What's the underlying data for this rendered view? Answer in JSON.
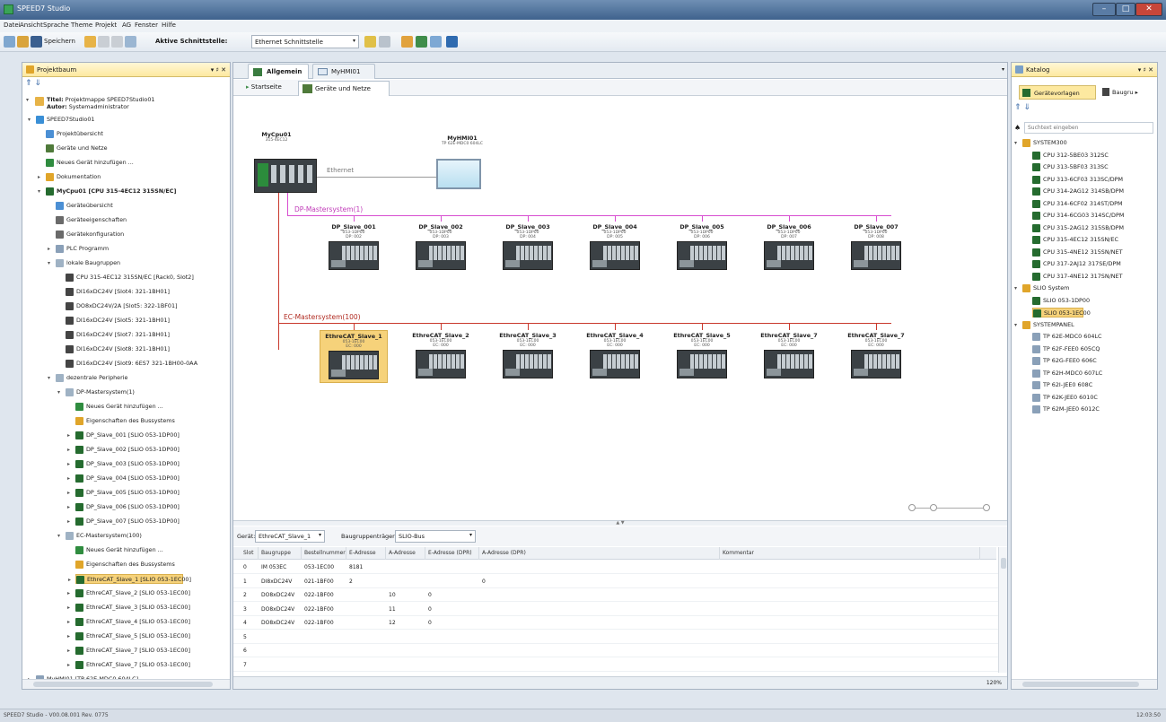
{
  "window": {
    "title": "SPEED7 Studio",
    "minimize": "–",
    "maximize": "□",
    "close": "✕"
  },
  "menu": [
    "Datei",
    "Ansicht",
    "Sprache",
    "Theme",
    "Projekt",
    "AG",
    "Fenster",
    "Hilfe"
  ],
  "toolbar": {
    "save_label": "Speichern",
    "interface_label": "Aktive Schnittstelle:",
    "interface_value": "Ethernet Schnittstelle"
  },
  "projecttree": {
    "title": "Projektbaum",
    "pin": "▾ ♯ ✕",
    "root_title_label": "Titel:",
    "root_title_value": "Projektmappe SPEED7Studio01",
    "root_author_label": "Autor:",
    "root_author_value": "Systemadministrator",
    "items": [
      {
        "label": "SPEED7Studio01",
        "indent": 1,
        "arrow": "▾",
        "color": "#3a8fd6"
      },
      {
        "label": "Projektübersicht",
        "indent": 2,
        "arrow": "",
        "color": "#4b8fd4"
      },
      {
        "label": "Geräte und Netze",
        "indent": 2,
        "arrow": "",
        "color": "#4f7a3a"
      },
      {
        "label": "Neues Gerät hinzufügen ...",
        "indent": 2,
        "arrow": "",
        "color": "#2f8c3f"
      },
      {
        "label": "Dokumentation",
        "indent": 2,
        "arrow": "▸",
        "color": "#e0a52a"
      },
      {
        "label": "MyCpu01 [CPU 315-4EC12 315SN/EC]",
        "indent": 2,
        "arrow": "▾",
        "color": "#256b2f",
        "bold": true
      },
      {
        "label": "Geräteübersicht",
        "indent": 3,
        "arrow": "",
        "color": "#4b8fd4"
      },
      {
        "label": "Geräteeigenschaften",
        "indent": 3,
        "arrow": "",
        "color": "#6a6a6a"
      },
      {
        "label": "Gerätekonfiguration",
        "indent": 3,
        "arrow": "",
        "color": "#6a6a6a"
      },
      {
        "label": "PLC Programm",
        "indent": 3,
        "arrow": "▸",
        "color": "#8aa0b8"
      },
      {
        "label": "lokale Baugruppen",
        "indent": 3,
        "arrow": "▾",
        "color": "#9fb2c4"
      },
      {
        "label": "CPU 315-4EC12 315SN/EC [Rack0, Slot2]",
        "indent": 4,
        "arrow": "",
        "color": "#444"
      },
      {
        "label": "DI16xDC24V [Slot4: 321-1BH01]",
        "indent": 4,
        "arrow": "",
        "color": "#444"
      },
      {
        "label": "DO8xDC24V/2A [Slot5: 322-1BF01]",
        "indent": 4,
        "arrow": "",
        "color": "#444"
      },
      {
        "label": "DI16xDC24V [Slot5: 321-1BH01]",
        "indent": 4,
        "arrow": "",
        "color": "#444"
      },
      {
        "label": "DI16xDC24V [Slot7: 321-1BH01]",
        "indent": 4,
        "arrow": "",
        "color": "#444"
      },
      {
        "label": "DI16xDC24V [Slot8: 321-1BH01]",
        "indent": 4,
        "arrow": "",
        "color": "#444"
      },
      {
        "label": "DI16xDC24V [Slot9: 6ES7 321-1BH00-0AA",
        "indent": 4,
        "arrow": "",
        "color": "#444"
      },
      {
        "label": "dezentrale Peripherie",
        "indent": 3,
        "arrow": "▾",
        "color": "#9fb2c4"
      },
      {
        "label": "DP-Mastersystem(1)",
        "indent": 4,
        "arrow": "▾",
        "color": "#9fb2c4"
      },
      {
        "label": "Neues Gerät hinzufügen ...",
        "indent": 5,
        "arrow": "",
        "color": "#2f8c3f"
      },
      {
        "label": "Eigenschaften des Bussystems",
        "indent": 5,
        "arrow": "",
        "color": "#e0a52a"
      },
      {
        "label": "DP_Slave_001 [SLIO 053-1DP00]",
        "indent": 5,
        "arrow": "▸",
        "color": "#256b2f"
      },
      {
        "label": "DP_Slave_002 [SLIO 053-1DP00]",
        "indent": 5,
        "arrow": "▸",
        "color": "#256b2f"
      },
      {
        "label": "DP_Slave_003 [SLIO 053-1DP00]",
        "indent": 5,
        "arrow": "▸",
        "color": "#256b2f"
      },
      {
        "label": "DP_Slave_004 [SLIO 053-1DP00]",
        "indent": 5,
        "arrow": "▸",
        "color": "#256b2f"
      },
      {
        "label": "DP_Slave_005 [SLIO 053-1DP00]",
        "indent": 5,
        "arrow": "▸",
        "color": "#256b2f"
      },
      {
        "label": "DP_Slave_006 [SLIO 053-1DP00]",
        "indent": 5,
        "arrow": "▸",
        "color": "#256b2f"
      },
      {
        "label": "DP_Slave_007 [SLIO 053-1DP00]",
        "indent": 5,
        "arrow": "▸",
        "color": "#256b2f"
      },
      {
        "label": "EC-Mastersystem(100)",
        "indent": 4,
        "arrow": "▾",
        "color": "#9fb2c4"
      },
      {
        "label": "Neues Gerät hinzufügen ...",
        "indent": 5,
        "arrow": "",
        "color": "#2f8c3f"
      },
      {
        "label": "Eigenschaften des Bussystems",
        "indent": 5,
        "arrow": "",
        "color": "#e0a52a"
      },
      {
        "label": "EthreCAT_Slave_1 [SLIO 053-1EC00]",
        "indent": 5,
        "arrow": "▸",
        "color": "#256b2f",
        "selected": true
      },
      {
        "label": "EthreCAT_Slave_2 [SLIO 053-1EC00]",
        "indent": 5,
        "arrow": "▸",
        "color": "#256b2f"
      },
      {
        "label": "EthreCAT_Slave_3 [SLIO 053-1EC00]",
        "indent": 5,
        "arrow": "▸",
        "color": "#256b2f"
      },
      {
        "label": "EthreCAT_Slave_4 [SLIO 053-1EC00]",
        "indent": 5,
        "arrow": "▸",
        "color": "#256b2f"
      },
      {
        "label": "EthreCAT_Slave_5 [SLIO 053-1EC00]",
        "indent": 5,
        "arrow": "▸",
        "color": "#256b2f"
      },
      {
        "label": "EthreCAT_Slave_7 [SLIO 053-1EC00]",
        "indent": 5,
        "arrow": "▸",
        "color": "#256b2f"
      },
      {
        "label": "EthreCAT_Slave_7 [SLIO 053-1EC00]",
        "indent": 5,
        "arrow": "▸",
        "color": "#256b2f"
      },
      {
        "label": "MyHMI01 [TP 62E-MDC0 604LC]",
        "indent": 1,
        "arrow": "▸",
        "color": "#8aa0b8"
      }
    ]
  },
  "tabs": {
    "main": [
      "Allgemein",
      "MyHMI01"
    ],
    "sub": [
      "Startseite",
      "Geräte und Netze"
    ]
  },
  "network": {
    "cpu_name": "MyCpu01",
    "cpu_sub": "315-4EC12",
    "hmi_name": "MyHMI01",
    "hmi_sub": "TP 62E-MDC0 604LC",
    "ethernet": "Ethernet",
    "dp_master": "DP-Mastersystem(1)",
    "ec_master": "EC-Mastersystem(100)",
    "dp_slaves": [
      {
        "name": "DP_Slave_001",
        "sub1": "053-1DP00",
        "sub2": "DP: 002"
      },
      {
        "name": "DP_Slave_002",
        "sub1": "053-1DP00",
        "sub2": "DP: 003"
      },
      {
        "name": "DP_Slave_003",
        "sub1": "053-1DP00",
        "sub2": "DP: 004"
      },
      {
        "name": "DP_Slave_004",
        "sub1": "053-1DP00",
        "sub2": "DP: 005"
      },
      {
        "name": "DP_Slave_005",
        "sub1": "053-1DP00",
        "sub2": "DP: 006"
      },
      {
        "name": "DP_Slave_006",
        "sub1": "053-1DP00",
        "sub2": "DP: 007"
      },
      {
        "name": "DP_Slave_007",
        "sub1": "053-1DP00",
        "sub2": "DP: 008"
      }
    ],
    "ec_slaves": [
      {
        "name": "EthreCAT_Slave_1",
        "sub1": "053-1EC00",
        "sub2": "EC: 000",
        "selected": true
      },
      {
        "name": "EthreCAT_Slave_2",
        "sub1": "053-1EC00",
        "sub2": "EC: 000"
      },
      {
        "name": "EthreCAT_Slave_3",
        "sub1": "053-1EC00",
        "sub2": "EC: 000"
      },
      {
        "name": "EthreCAT_Slave_4",
        "sub1": "053-1EC00",
        "sub2": "EC: 000"
      },
      {
        "name": "EthreCAT_Slave_5",
        "sub1": "053-1EC00",
        "sub2": "EC: 000"
      },
      {
        "name": "EthreCAT_Slave_7",
        "sub1": "053-1EC00",
        "sub2": "EC: 000"
      },
      {
        "name": "EthreCAT_Slave_7",
        "sub1": "053-1EC00",
        "sub2": "EC: 000"
      }
    ]
  },
  "devicegrid": {
    "geraet_label": "Gerät:",
    "geraet_value": "EthreCAT_Slave_1",
    "traeger_label": "Baugruppenträger:",
    "traeger_value": "SLIO-Bus",
    "columns": [
      "Slot",
      "Baugruppe",
      "Bestellnummer",
      "E-Adresse",
      "A-Adresse",
      "E-Adresse (DPR)",
      "A-Adresse (DPR)",
      "Kommentar"
    ],
    "rows": [
      [
        "0",
        "IM 053EC",
        "053-1EC00",
        "8181",
        "",
        "",
        "",
        ""
      ],
      [
        "1",
        "DI8xDC24V",
        "021-1BF00",
        "2",
        "",
        "",
        "0",
        ""
      ],
      [
        "2",
        "DO8xDC24V",
        "022-1BF00",
        "",
        "10",
        "0",
        "",
        ""
      ],
      [
        "3",
        "DO8xDC24V",
        "022-1BF00",
        "",
        "11",
        "0",
        "",
        ""
      ],
      [
        "4",
        "DO8xDC24V",
        "022-1BF00",
        "",
        "12",
        "0",
        "",
        ""
      ],
      [
        "5",
        "",
        "",
        "",
        "",
        "",
        "",
        ""
      ],
      [
        "6",
        "",
        "",
        "",
        "",
        "",
        "",
        ""
      ],
      [
        "7",
        "",
        "",
        "",
        "",
        "",
        "",
        ""
      ]
    ],
    "zoom": "120%"
  },
  "catalog": {
    "title": "Katalog",
    "pin": "▾ ♯ ✕",
    "tab1": "Gerätevorlagen",
    "tab2": "Baugru",
    "search_placeholder": "Suchtext eingeben",
    "items": [
      {
        "label": "SYSTEM300",
        "indent": 0,
        "arrow": "▾",
        "color": "#e0a52a"
      },
      {
        "label": "CPU 312-5BE03 312SC",
        "indent": 1,
        "arrow": "",
        "color": "#256b2f"
      },
      {
        "label": "CPU 313-5BF03 313SC",
        "indent": 1,
        "arrow": "",
        "color": "#256b2f"
      },
      {
        "label": "CPU 313-6CF03 313SC/DPM",
        "indent": 1,
        "arrow": "",
        "color": "#256b2f"
      },
      {
        "label": "CPU 314-2AG12 314SB/DPM",
        "indent": 1,
        "arrow": "",
        "color": "#256b2f"
      },
      {
        "label": "CPU 314-6CF02 314ST/DPM",
        "indent": 1,
        "arrow": "",
        "color": "#256b2f"
      },
      {
        "label": "CPU 314-6CG03 314SC/DPM",
        "indent": 1,
        "arrow": "",
        "color": "#256b2f"
      },
      {
        "label": "CPU 315-2AG12 315SB/DPM",
        "indent": 1,
        "arrow": "",
        "color": "#256b2f"
      },
      {
        "label": "CPU 315-4EC12 315SN/EC",
        "indent": 1,
        "arrow": "",
        "color": "#256b2f"
      },
      {
        "label": "CPU 315-4NE12 315SN/NET",
        "indent": 1,
        "arrow": "",
        "color": "#256b2f"
      },
      {
        "label": "CPU 317-2AJ12 317SE/DPM",
        "indent": 1,
        "arrow": "",
        "color": "#256b2f"
      },
      {
        "label": "CPU 317-4NE12 317SN/NET",
        "indent": 1,
        "arrow": "",
        "color": "#256b2f"
      },
      {
        "label": "SLIO System",
        "indent": 0,
        "arrow": "▾",
        "color": "#e0a52a"
      },
      {
        "label": "SLIO 053-1DP00",
        "indent": 1,
        "arrow": "",
        "color": "#256b2f"
      },
      {
        "label": "SLIO 053-1EC00",
        "indent": 1,
        "arrow": "",
        "color": "#256b2f",
        "selected": true
      },
      {
        "label": "SYSTEMPANEL",
        "indent": 0,
        "arrow": "▾",
        "color": "#e0a52a"
      },
      {
        "label": "TP 62E-MDC0 604LC",
        "indent": 1,
        "arrow": "",
        "color": "#8aa0b8"
      },
      {
        "label": "TP 62F-FEE0 605CQ",
        "indent": 1,
        "arrow": "",
        "color": "#8aa0b8"
      },
      {
        "label": "TP 62G-FEE0 606C",
        "indent": 1,
        "arrow": "",
        "color": "#8aa0b8"
      },
      {
        "label": "TP 62H-MDC0 607LC",
        "indent": 1,
        "arrow": "",
        "color": "#8aa0b8"
      },
      {
        "label": "TP 62I-JEE0 608C",
        "indent": 1,
        "arrow": "",
        "color": "#8aa0b8"
      },
      {
        "label": "TP 62K-JEE0 6010C",
        "indent": 1,
        "arrow": "",
        "color": "#8aa0b8"
      },
      {
        "label": "TP 62M-JEE0 6012C",
        "indent": 1,
        "arrow": "",
        "color": "#8aa0b8"
      }
    ]
  },
  "statusbar": {
    "left": "SPEED7 Studio - V00.08.001 Rev. 0775",
    "right": "12:03:50"
  },
  "colors": {
    "dp_line": "#d84fd1",
    "ec_line": "#c9392d",
    "select": "#f6d27a",
    "accent": "#fde9a0"
  }
}
